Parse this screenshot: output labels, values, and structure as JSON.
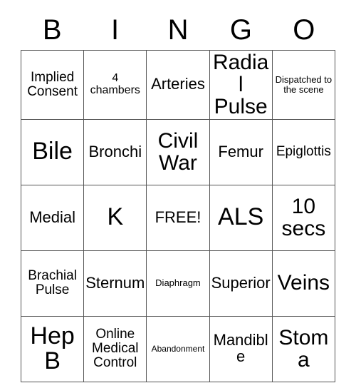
{
  "card": {
    "header_letters": [
      "B",
      "I",
      "N",
      "G",
      "O"
    ],
    "columns": [
      {
        "letter": "B",
        "cells": [
          {
            "text": "Implied Consent",
            "size": "sm"
          },
          {
            "text": "Bile",
            "size": "xxl"
          },
          {
            "text": "Medial",
            "size": "md"
          },
          {
            "text": "Brachial Pulse",
            "size": "sm"
          },
          {
            "text": "Hep B",
            "size": "xxl"
          }
        ]
      },
      {
        "letter": "I",
        "cells": [
          {
            "text": "4 chambers",
            "size": "xs"
          },
          {
            "text": "Bronchi",
            "size": "md"
          },
          {
            "text": "K",
            "size": "xxl"
          },
          {
            "text": "Sternum",
            "size": "md"
          },
          {
            "text": "Online Medical Control",
            "size": "sm"
          }
        ]
      },
      {
        "letter": "N",
        "cells": [
          {
            "text": "Arteries",
            "size": "md"
          },
          {
            "text": "Civil War",
            "size": "xl"
          },
          {
            "text": "FREE!",
            "size": "md"
          },
          {
            "text": "Diaphragm",
            "size": "xxs"
          },
          {
            "text": "Abandonment",
            "size": "tiny"
          }
        ]
      },
      {
        "letter": "G",
        "cells": [
          {
            "text": "Radial Pulse",
            "size": "xl"
          },
          {
            "text": "Femur",
            "size": "md"
          },
          {
            "text": "ALS",
            "size": "xxl"
          },
          {
            "text": "Superior",
            "size": "md"
          },
          {
            "text": "Mandible",
            "size": "md"
          }
        ]
      },
      {
        "letter": "O",
        "cells": [
          {
            "text": "Dispatched to the scene",
            "size": "xxs"
          },
          {
            "text": "Epiglottis",
            "size": "sm"
          },
          {
            "text": "10 secs",
            "size": "xl"
          },
          {
            "text": "Veins",
            "size": "xl"
          },
          {
            "text": "Stoma",
            "size": "xl"
          }
        ]
      }
    ],
    "free_space_label": "FREE!",
    "colors": {
      "background": "#ffffff",
      "text": "#000000",
      "grid_line": "#555555"
    }
  }
}
